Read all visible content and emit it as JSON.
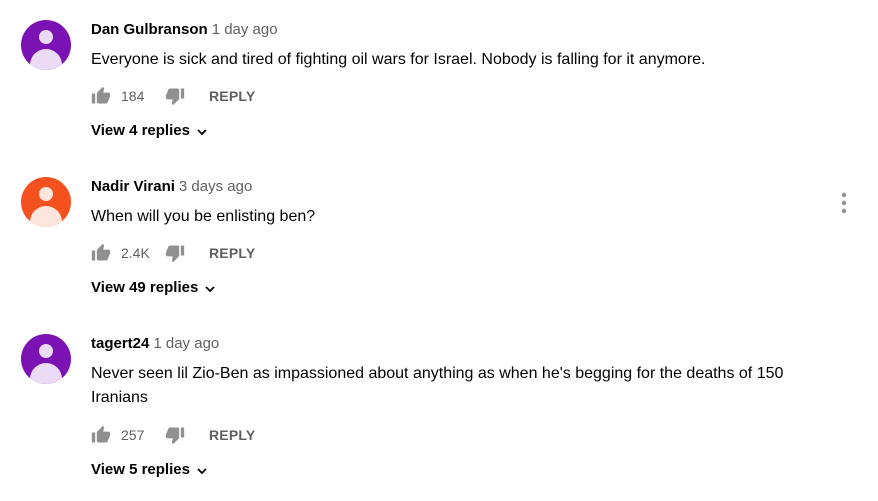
{
  "comments": [
    {
      "author": "Dan Gulbranson",
      "time": "1 day ago",
      "text": "Everyone is sick and tired of fighting oil wars for Israel. Nobody is falling for it anymore.",
      "likes": "184",
      "reply_label": "REPLY",
      "view_replies": "View 4 replies",
      "avatar_color": "#7b12b3"
    },
    {
      "author": "Nadir Virani",
      "time": "3 days ago",
      "text": "When will you be enlisting ben?",
      "likes": "2.4K",
      "reply_label": "REPLY",
      "view_replies": "View 49 replies",
      "avatar_color": "#f4511e"
    },
    {
      "author": "tagert24",
      "time": "1 day ago",
      "text": "Never seen lil Zio-Ben as impassioned about anything as when he's begging for the deaths of 150 Iranians",
      "likes": "257",
      "reply_label": "REPLY",
      "view_replies": "View 5 replies",
      "avatar_color": "#7b12b3"
    }
  ],
  "icons": {
    "like": "thumb-up-icon",
    "dislike": "thumb-down-icon",
    "expand": "chevron-down-icon",
    "menu": "more-vert-icon"
  }
}
